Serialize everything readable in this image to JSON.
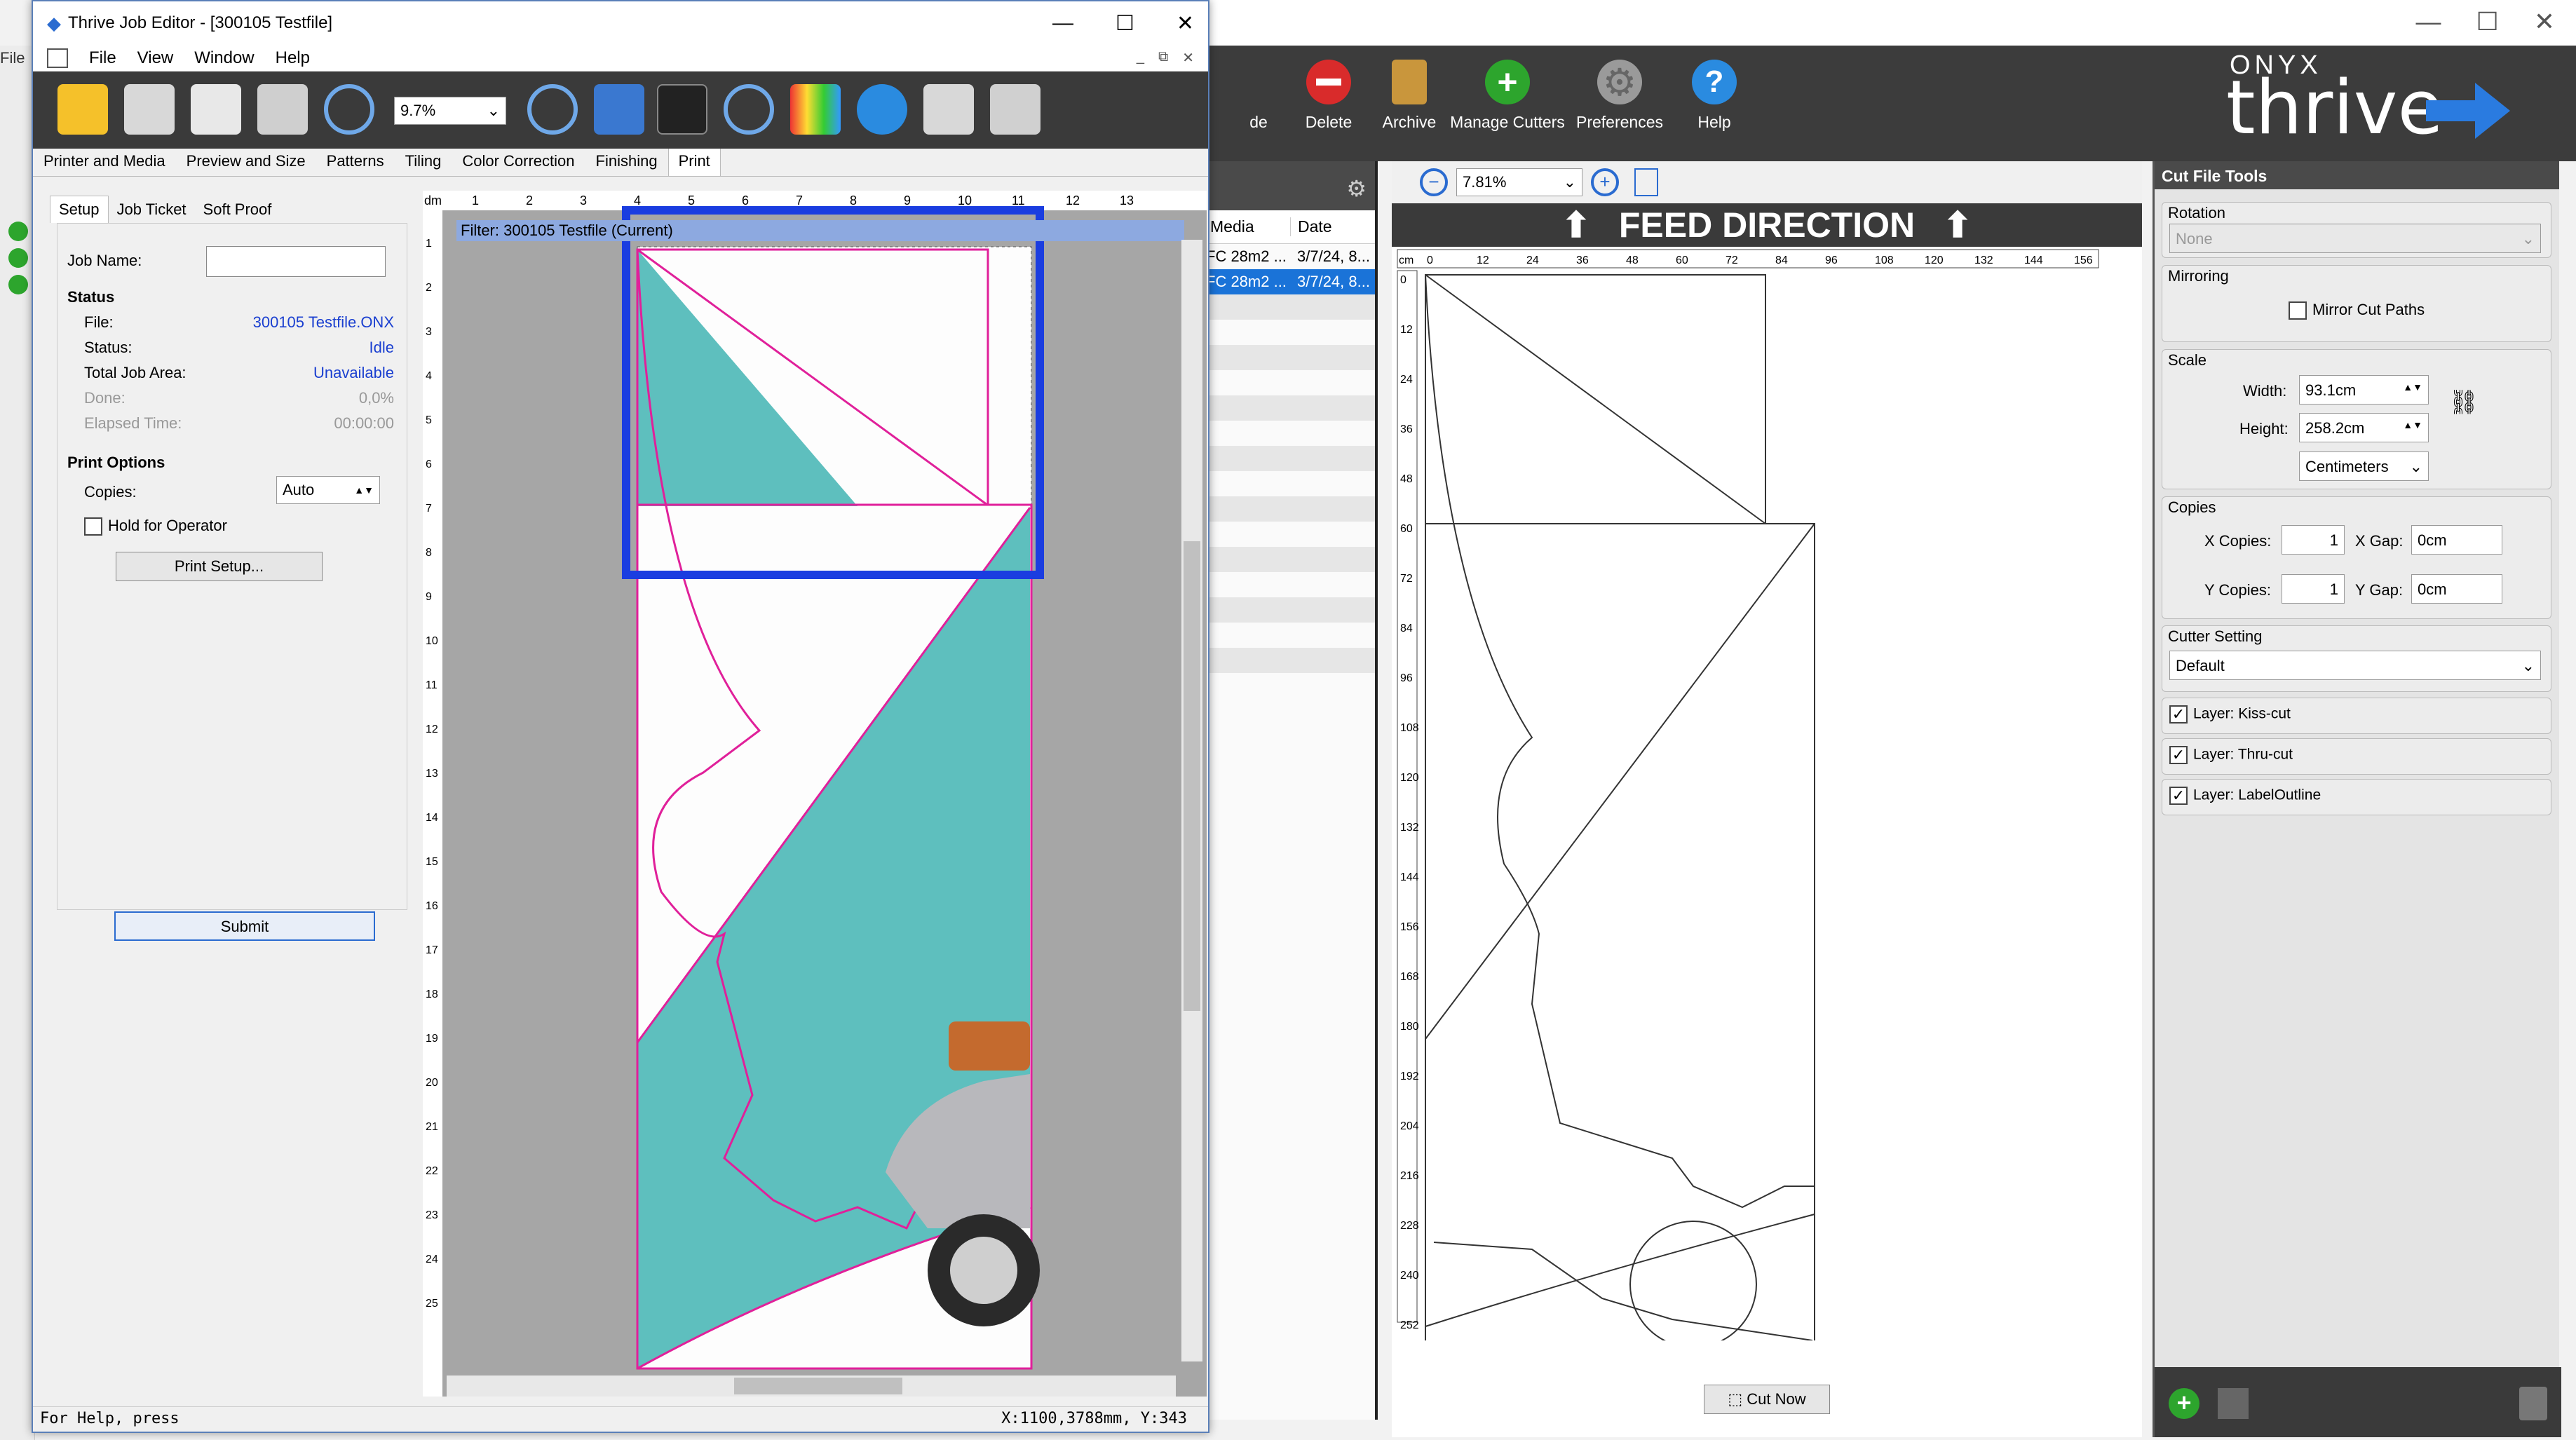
{
  "background_app": {
    "menu_partial": "File",
    "toolbar": [
      {
        "label": "de",
        "icon": "delete-partial-icon"
      },
      {
        "label": "Delete",
        "icon": "delete-icon",
        "color": "#d92b2b"
      },
      {
        "label": "Archive",
        "icon": "archive-icon",
        "color": "#c9963c"
      },
      {
        "label": "Manage Cutters",
        "icon": "add-icon",
        "color": "#2da52d"
      },
      {
        "label": "Preferences",
        "icon": "gear-icon",
        "color": "#9a9a9a"
      },
      {
        "label": "Help",
        "icon": "help-icon",
        "color": "#2a8be0"
      }
    ],
    "logo_top": "ONYX",
    "logo_main": "thrive",
    "media_list": {
      "columns": [
        "Media",
        "Date"
      ],
      "rows": [
        {
          "media": "FC 28m2 ...",
          "date": "3/7/24, 8...",
          "selected": false
        },
        {
          "media": "FC 28m2 ...",
          "date": "3/7/24, 8...",
          "selected": true
        }
      ]
    },
    "preview": {
      "zoom": "7.81%",
      "feed_direction": "FEED DIRECTION",
      "ruler_unit": "cm",
      "h_ticks": [
        "0",
        "12",
        "24",
        "36",
        "48",
        "60",
        "72",
        "84",
        "96",
        "108",
        "120",
        "132",
        "144",
        "156"
      ],
      "v_ticks": [
        "0",
        "12",
        "24",
        "36",
        "48",
        "60",
        "72",
        "84",
        "96",
        "108",
        "120",
        "132",
        "144",
        "156",
        "168",
        "180",
        "192",
        "204",
        "216",
        "228",
        "240",
        "252"
      ],
      "cut_now": "Cut Now"
    },
    "cut_file_tools": {
      "title": "Cut File Tools",
      "rotation_label": "Rotation",
      "rotation_value": "None",
      "mirroring_label": "Mirroring",
      "mirror_cut_paths": "Mirror Cut Paths",
      "scale_label": "Scale",
      "width_label": "Width:",
      "width_value": "93.1cm",
      "height_label": "Height:",
      "height_value": "258.2cm",
      "units": "Centimeters",
      "copies_label": "Copies",
      "x_copies_label": "X Copies:",
      "x_copies_value": "1",
      "x_gap_label": "X Gap:",
      "x_gap_value": "0cm",
      "y_copies_label": "Y Copies:",
      "y_copies_value": "1",
      "y_gap_label": "Y Gap:",
      "y_gap_value": "0cm",
      "cutter_setting_label": "Cutter Setting",
      "cutter_setting_value": "Default",
      "layers": [
        "Layer: Kiss-cut",
        "Layer: Thru-cut",
        "Layer: LabelOutline"
      ]
    }
  },
  "job_editor": {
    "title": "Thrive Job Editor - [300105 Testfile]",
    "menu": [
      "File",
      "View",
      "Window",
      "Help"
    ],
    "zoom": "9.7%",
    "tabs": [
      "Printer and Media",
      "Preview and Size",
      "Patterns",
      "Tiling",
      "Color Correction",
      "Finishing",
      "Print"
    ],
    "active_tab": "Print",
    "subtabs": [
      "Setup",
      "Job Ticket",
      "Soft Proof"
    ],
    "setup": {
      "job_name_label": "Job Name:",
      "job_name_value": "",
      "status_heading": "Status",
      "file_label": "File:",
      "file_value": "300105 Testfile.ONX",
      "status_label": "Status:",
      "status_value": "Idle",
      "area_label": "Total Job Area:",
      "area_value": "Unavailable",
      "done_label": "Done:",
      "done_value": "0,0%",
      "elapsed_label": "Elapsed Time:",
      "elapsed_value": "00:00:00",
      "print_options_heading": "Print Options",
      "copies_label": "Copies:",
      "copies_value": "Auto",
      "hold_label": "Hold for Operator",
      "print_setup_button": "Print Setup...",
      "submit_button": "Submit"
    },
    "canvas": {
      "ruler_unit": "dm",
      "h_ticks": [
        "1",
        "2",
        "3",
        "4",
        "5",
        "6",
        "7",
        "8",
        "9",
        "10",
        "11",
        "12",
        "13"
      ],
      "v_ticks": [
        "1",
        "2",
        "3",
        "4",
        "5",
        "6",
        "7",
        "8",
        "9",
        "10",
        "11",
        "12",
        "13",
        "14",
        "15",
        "16",
        "17",
        "18",
        "19",
        "20",
        "21",
        "22",
        "23",
        "24",
        "25"
      ],
      "filter_label": "Filter: 300105 Testfile (Current)",
      "teal_color": "#5ebfbe",
      "cut_line_color": "#e0209a",
      "highlight_color": "#1a3de0"
    },
    "status_left": "For Help, press",
    "status_right": "X:1100,3788mm, Y:343"
  }
}
